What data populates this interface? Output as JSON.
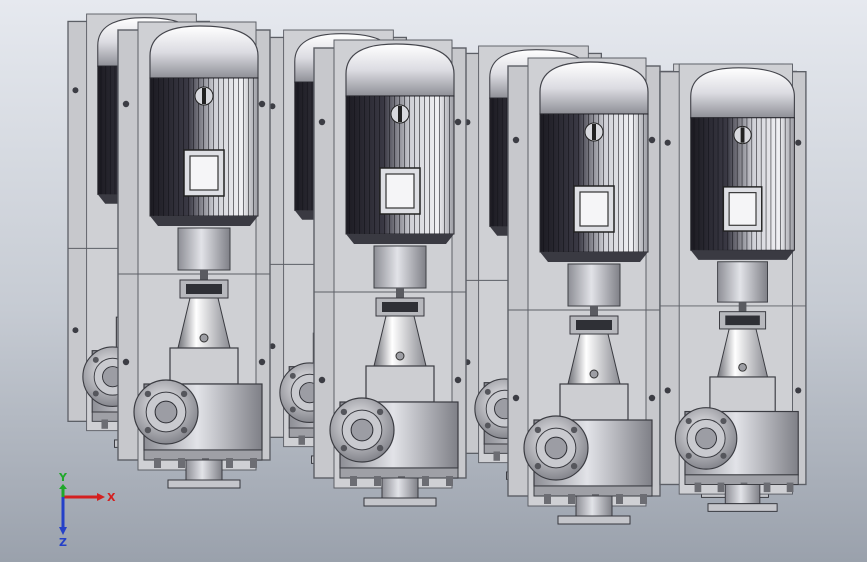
{
  "scene": {
    "background_top": "#e4e8ee",
    "background_bottom": "#9aa2ad",
    "unit_count": 8
  },
  "colors": {
    "plate": "#c7c8cc",
    "plate_edge": "#5c5f66",
    "motor_dark": "#2e2d35",
    "motor_light": "#d9d9de",
    "cap": "#e6e6ea",
    "metal": "#b9bac0"
  },
  "triad": {
    "x_label": "X",
    "y_label": "Y",
    "z_label": "Z",
    "x_color": "#d42020",
    "y_color": "#1fa82a",
    "z_color": "#2440c8"
  }
}
